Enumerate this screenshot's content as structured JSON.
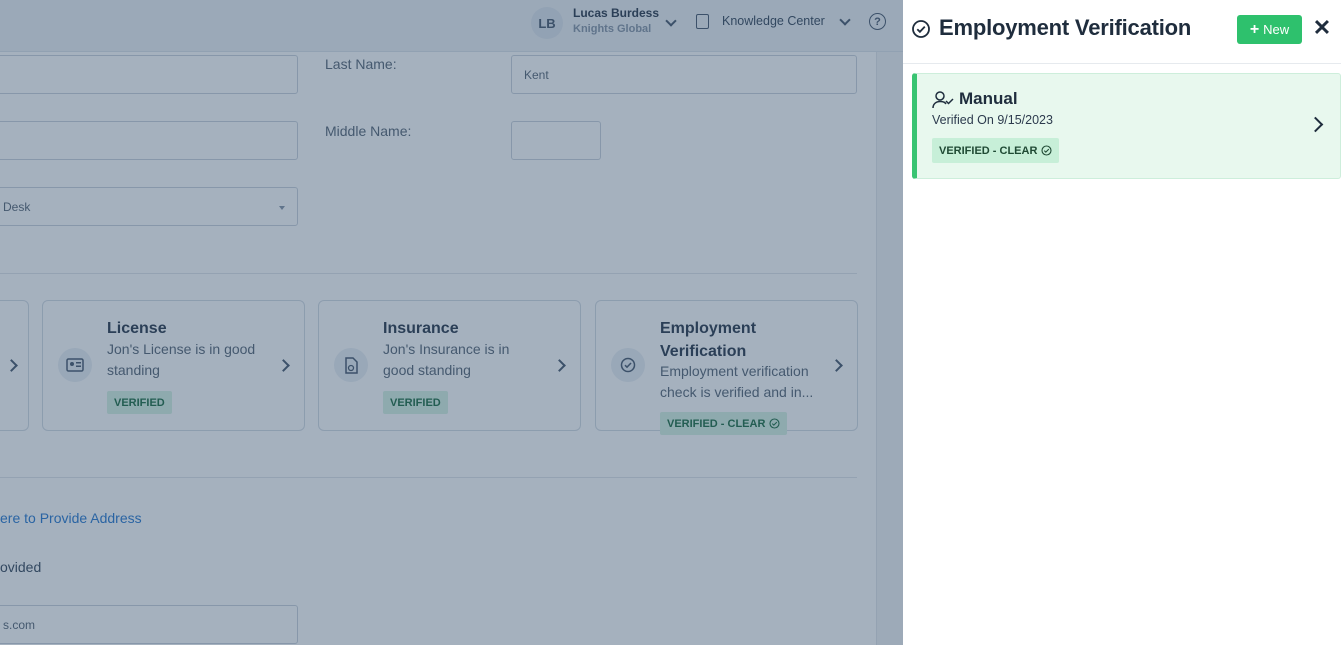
{
  "topbar": {
    "avatar_initials": "LB",
    "user_name": "Lucas Burdess",
    "user_org": "Knights Global",
    "knowledge_center_label": "Knowledge Center",
    "help_label": "?"
  },
  "form": {
    "last_name_label": "Last Name:",
    "last_name_value": "Kent",
    "middle_name_label": "Middle Name:",
    "middle_name_value": "",
    "department_value": "Desk",
    "email_value": "s.com"
  },
  "cards": [
    {
      "title": "License",
      "description": "Jon's License is in good standing",
      "badge": "VERIFIED",
      "icon": "id-card-icon"
    },
    {
      "title": "Insurance",
      "description": "Jon's Insurance is in good standing",
      "badge": "VERIFIED",
      "icon": "insurance-document-icon"
    },
    {
      "title": "Employment Verification",
      "description": "Employment verification check is verified and in...",
      "badge": "VERIFIED - CLEAR",
      "icon": "check-circle-icon"
    }
  ],
  "address": {
    "link_text": "ere to Provide Address",
    "provided_text": "ovided"
  },
  "panel": {
    "title": "Employment Verification",
    "new_button_label": "New",
    "close_label": "✕",
    "record": {
      "title": "Manual",
      "subtitle": "Verified On 9/15/2023",
      "badge": "VERIFIED - CLEAR"
    }
  },
  "colors": {
    "accent_green": "#2ec16d",
    "verified_bg": "#e8f8ee",
    "overlay": "#28466a"
  }
}
